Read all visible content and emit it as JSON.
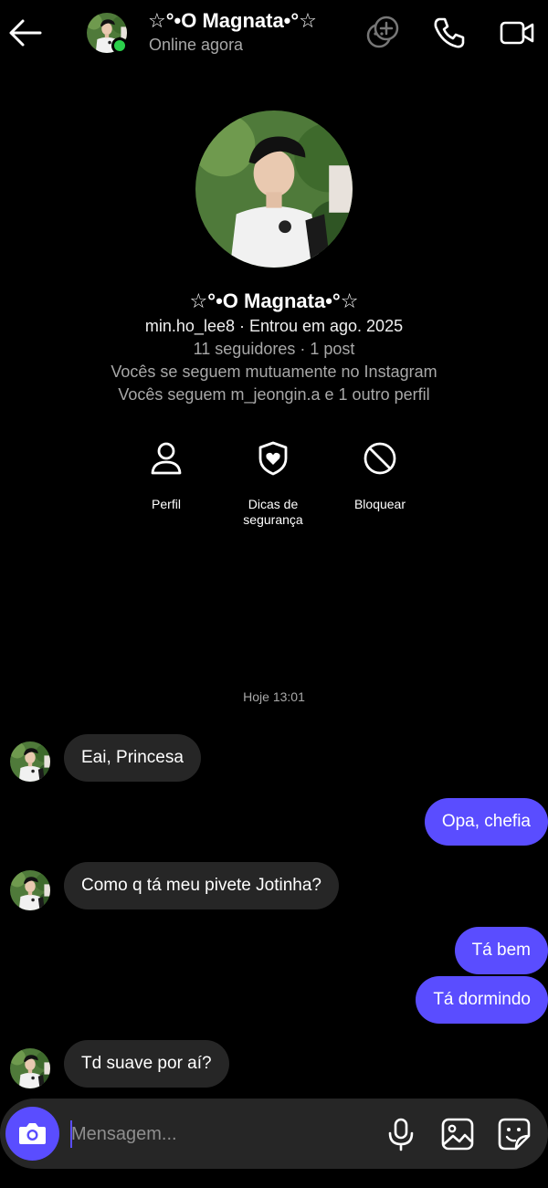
{
  "header": {
    "name": "☆°•O Magnata•°☆",
    "status": "Online agora",
    "icons": [
      "back-arrow-icon",
      "avatar",
      "add-effects-icon",
      "phone-icon",
      "video-camera-icon"
    ]
  },
  "profile": {
    "name": "☆°•O Magnata•°☆",
    "username_line": "min.ho_lee8 · Entrou em ago. 2025",
    "stats": "11 seguidores · 1 post",
    "mutual_follow": "Vocês se seguem mutuamente no Instagram",
    "mutual_friends": "Vocês seguem m_jeongin.a e 1 outro perfil",
    "actions": [
      {
        "label": "Perfil",
        "icon": "person-icon"
      },
      {
        "label": "Dicas de segurança",
        "icon": "shield-heart-icon"
      },
      {
        "label": "Bloquear",
        "icon": "block-icon"
      }
    ]
  },
  "chat": {
    "timestamp": "Hoje 13:01",
    "messages": [
      {
        "from": "them",
        "text": "Eai, Princesa"
      },
      {
        "from": "me",
        "text": "Opa, chefia"
      },
      {
        "from": "them",
        "text": "Como q tá meu pivete Jotinha?"
      },
      {
        "from": "me",
        "text": "Tá bem"
      },
      {
        "from": "me",
        "text": "Tá dormindo"
      },
      {
        "from": "them",
        "text": "Td suave por aí?"
      }
    ]
  },
  "composer": {
    "placeholder": "Mensagem...",
    "icons": [
      "camera-icon",
      "microphone-icon",
      "gallery-icon",
      "sticker-icon"
    ]
  },
  "colors": {
    "background": "#000000",
    "accent": "#5a4dff",
    "incoming_bubble": "#262626",
    "online": "#2bd04b",
    "secondary_text": "#a8a8a8"
  }
}
